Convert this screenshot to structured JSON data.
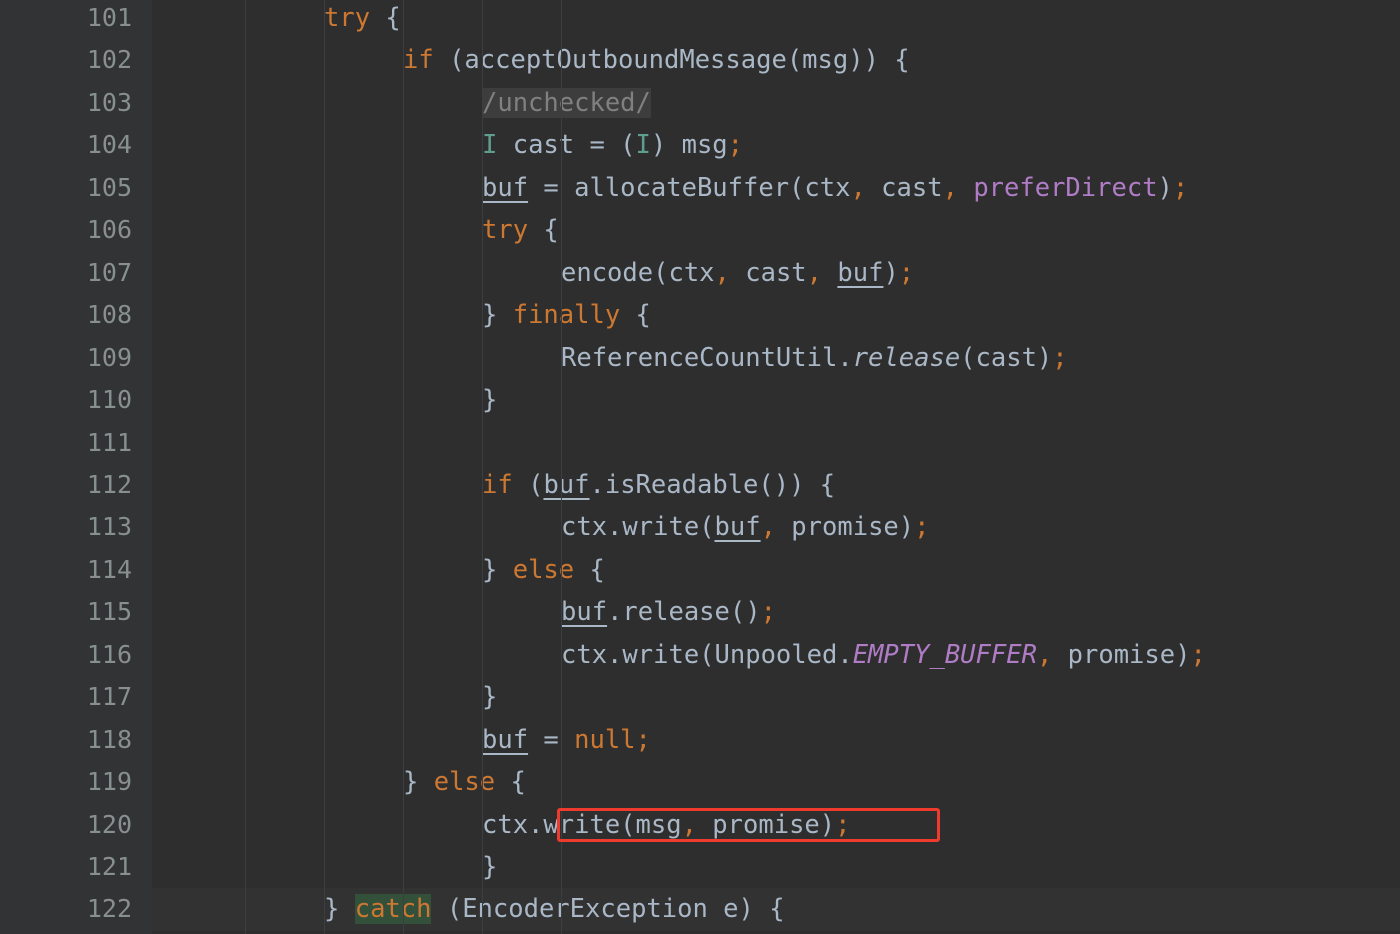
{
  "editor": {
    "language": "java",
    "theme": "darcula",
    "first_line": 101,
    "last_line": 122,
    "current_line": 122,
    "colors": {
      "background": "#2e2e2e",
      "gutter_background": "#313335",
      "gutter_text": "#888f8f",
      "default_text": "#a9b7c6",
      "keyword": "#cc7832",
      "type": "#5f9e8f",
      "field": "#b07cc6",
      "comment": "#808080",
      "comment_highlight": "#3d3d3d",
      "brace_match_highlight": "#32503a",
      "current_line_highlight": "#323232",
      "indent_guide": "#3b3f41",
      "annotation_box": "#ef3b2d"
    }
  },
  "gutter": {
    "numbers": [
      "101",
      "102",
      "103",
      "104",
      "105",
      "106",
      "107",
      "108",
      "109",
      "110",
      "111",
      "112",
      "113",
      "114",
      "115",
      "116",
      "117",
      "118",
      "119",
      "120",
      "121",
      "122"
    ]
  },
  "annotation": {
    "name": "red-highlight-box",
    "target_line": 120,
    "target_text": "write(msg, promise)",
    "color": "#ef3b2d"
  },
  "code": {
    "lines": [
      {
        "number": "101",
        "indent": 8,
        "tokens": [
          {
            "t": "try",
            "c": "kw"
          },
          {
            "t": " ",
            "c": "punct"
          },
          {
            "t": "{",
            "c": "punct"
          }
        ]
      },
      {
        "number": "102",
        "indent": 12,
        "tokens": [
          {
            "t": "if",
            "c": "kw"
          },
          {
            "t": " (acceptOutboundMessage(msg)) {",
            "c": "id"
          }
        ]
      },
      {
        "number": "103",
        "indent": 16,
        "tokens": [
          {
            "t": "/unchecked/",
            "c": "cmt"
          }
        ]
      },
      {
        "number": "104",
        "indent": 16,
        "tokens": [
          {
            "t": "I",
            "c": "type"
          },
          {
            "t": " cast = (",
            "c": "id"
          },
          {
            "t": "I",
            "c": "type"
          },
          {
            "t": ") msg",
            "c": "id"
          },
          {
            "t": ";",
            "c": "semi"
          }
        ]
      },
      {
        "number": "105",
        "indent": 16,
        "tokens": [
          {
            "t": "buf",
            "c": "local"
          },
          {
            "t": " = allocateBuffer(ctx",
            "c": "id"
          },
          {
            "t": ",",
            "c": "semi"
          },
          {
            "t": " cast",
            "c": "id"
          },
          {
            "t": ",",
            "c": "semi"
          },
          {
            "t": " ",
            "c": "id"
          },
          {
            "t": "preferDirect",
            "c": "field"
          },
          {
            "t": ")",
            "c": "id"
          },
          {
            "t": ";",
            "c": "semi"
          }
        ]
      },
      {
        "number": "106",
        "indent": 16,
        "tokens": [
          {
            "t": "try",
            "c": "kw"
          },
          {
            "t": " {",
            "c": "punct"
          }
        ]
      },
      {
        "number": "107",
        "indent": 20,
        "tokens": [
          {
            "t": "encode(ctx",
            "c": "id"
          },
          {
            "t": ",",
            "c": "semi"
          },
          {
            "t": " cast",
            "c": "id"
          },
          {
            "t": ",",
            "c": "semi"
          },
          {
            "t": " ",
            "c": "id"
          },
          {
            "t": "buf",
            "c": "local"
          },
          {
            "t": ")",
            "c": "id"
          },
          {
            "t": ";",
            "c": "semi"
          }
        ]
      },
      {
        "number": "108",
        "indent": 16,
        "tokens": [
          {
            "t": "} ",
            "c": "punct"
          },
          {
            "t": "finally",
            "c": "kw"
          },
          {
            "t": " {",
            "c": "punct"
          }
        ]
      },
      {
        "number": "109",
        "indent": 20,
        "tokens": [
          {
            "t": "ReferenceCountUtil.",
            "c": "id"
          },
          {
            "t": "release",
            "c": "smeth"
          },
          {
            "t": "(cast)",
            "c": "id"
          },
          {
            "t": ";",
            "c": "semi"
          }
        ]
      },
      {
        "number": "110",
        "indent": 16,
        "tokens": [
          {
            "t": "}",
            "c": "punct"
          }
        ]
      },
      {
        "number": "111",
        "indent": 0,
        "tokens": []
      },
      {
        "number": "112",
        "indent": 16,
        "tokens": [
          {
            "t": "if",
            "c": "kw"
          },
          {
            "t": " (",
            "c": "id"
          },
          {
            "t": "buf",
            "c": "local"
          },
          {
            "t": ".isReadable()) {",
            "c": "id"
          }
        ]
      },
      {
        "number": "113",
        "indent": 20,
        "tokens": [
          {
            "t": "ctx.write(",
            "c": "id"
          },
          {
            "t": "buf",
            "c": "local"
          },
          {
            "t": ",",
            "c": "semi"
          },
          {
            "t": " promise)",
            "c": "id"
          },
          {
            "t": ";",
            "c": "semi"
          }
        ]
      },
      {
        "number": "114",
        "indent": 16,
        "tokens": [
          {
            "t": "} ",
            "c": "punct"
          },
          {
            "t": "else",
            "c": "kw"
          },
          {
            "t": " {",
            "c": "punct"
          }
        ]
      },
      {
        "number": "115",
        "indent": 20,
        "tokens": [
          {
            "t": "buf",
            "c": "local"
          },
          {
            "t": ".release()",
            "c": "id"
          },
          {
            "t": ";",
            "c": "semi"
          }
        ]
      },
      {
        "number": "116",
        "indent": 20,
        "tokens": [
          {
            "t": "ctx.write(Unpooled.",
            "c": "id"
          },
          {
            "t": "EMPTY_BUFFER",
            "c": "sfield"
          },
          {
            "t": ",",
            "c": "semi"
          },
          {
            "t": " promise)",
            "c": "id"
          },
          {
            "t": ";",
            "c": "semi"
          }
        ]
      },
      {
        "number": "117",
        "indent": 16,
        "tokens": [
          {
            "t": "}",
            "c": "punct"
          }
        ]
      },
      {
        "number": "118",
        "indent": 16,
        "tokens": [
          {
            "t": "buf",
            "c": "local"
          },
          {
            "t": " = ",
            "c": "id"
          },
          {
            "t": "null",
            "c": "kw"
          },
          {
            "t": ";",
            "c": "semi"
          }
        ]
      },
      {
        "number": "119",
        "indent": 12,
        "tokens": [
          {
            "t": "} ",
            "c": "punct"
          },
          {
            "t": "else",
            "c": "kw"
          },
          {
            "t": " {",
            "c": "punct"
          }
        ]
      },
      {
        "number": "120",
        "indent": 16,
        "tokens": [
          {
            "t": "ctx.write(msg",
            "c": "id"
          },
          {
            "t": ",",
            "c": "semi"
          },
          {
            "t": " promise)",
            "c": "id"
          },
          {
            "t": ";",
            "c": "semi"
          }
        ]
      },
      {
        "number": "121",
        "indent": 16,
        "tokens": [
          {
            "t": "}",
            "c": "punct"
          }
        ]
      },
      {
        "number": "122",
        "indent": 8,
        "tokens": [
          {
            "t": "} ",
            "c": "punct"
          },
          {
            "t": "catch",
            "c": "kw bracehl"
          },
          {
            "t": " (EncoderException e) {",
            "c": "id"
          }
        ]
      }
    ]
  }
}
